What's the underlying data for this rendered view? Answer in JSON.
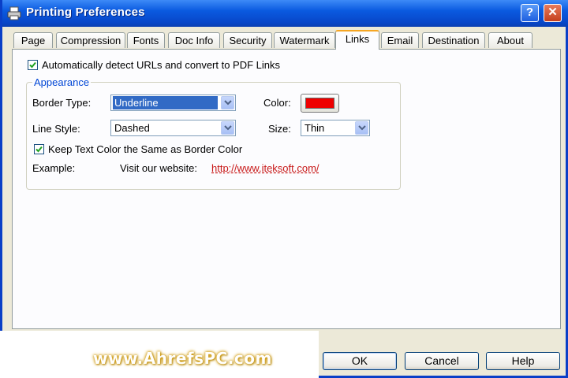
{
  "window": {
    "title": "Printing Preferences",
    "help_glyph": "?",
    "close_glyph": "✕"
  },
  "tabs": [
    {
      "label": "Page"
    },
    {
      "label": "Compression"
    },
    {
      "label": "Fonts"
    },
    {
      "label": "Doc Info"
    },
    {
      "label": "Security"
    },
    {
      "label": "Watermark"
    },
    {
      "label": "Links",
      "active": true
    },
    {
      "label": "Email"
    },
    {
      "label": "Destination"
    },
    {
      "label": "About"
    }
  ],
  "links_tab": {
    "auto_detect": {
      "label": "Automatically detect URLs and  convert to PDF Links",
      "checked": true
    },
    "appearance": {
      "title": "Appearance",
      "border_type_label": "Border Type:",
      "border_type_value": "Underline",
      "color_label": "Color:",
      "color_value": "#ee0000",
      "line_style_label": "Line Style:",
      "line_style_value": "Dashed",
      "size_label": "Size:",
      "size_value": "Thin",
      "keep_color": {
        "label": "Keep Text Color the Same as Border Color",
        "checked": true
      },
      "example_label": "Example:",
      "example_text": "Visit our website:",
      "example_link": "http://www.iteksoft.com/"
    }
  },
  "buttons": {
    "ok": "OK",
    "cancel": "Cancel",
    "help": "Help"
  },
  "watermark_text": "www.AhrefsPC.com",
  "colors": {
    "title_blue": "#0a5ae0",
    "face": "#ece9d8",
    "selection": "#316ac5",
    "link": "#c81a1a"
  }
}
